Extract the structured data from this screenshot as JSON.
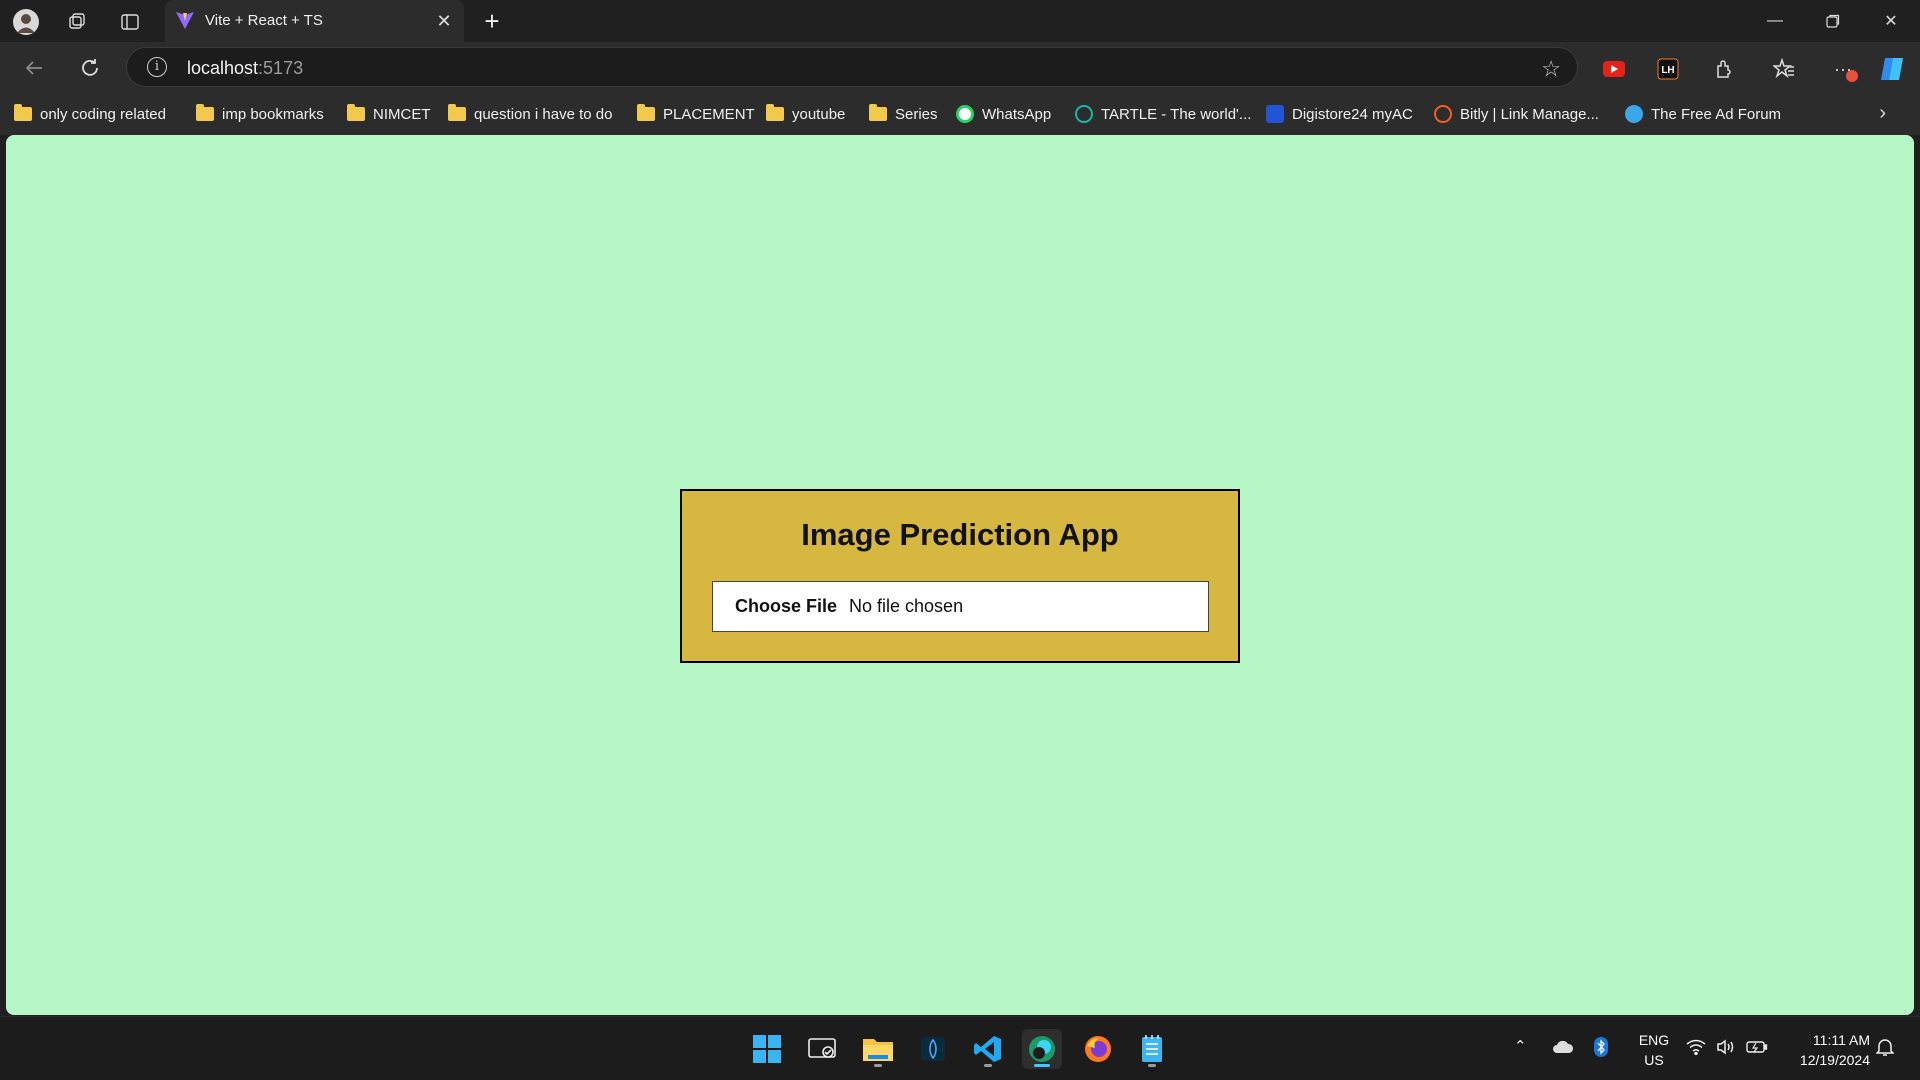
{
  "browser": {
    "tab_title": "Vite + React + TS",
    "url_host": "localhost",
    "url_port": ":5173"
  },
  "bookmarks": [
    {
      "label": "only coding  related",
      "icon": "folder-icon"
    },
    {
      "label": "imp bookmarks",
      "icon": "folder-icon"
    },
    {
      "label": "NIMCET",
      "icon": "folder-icon"
    },
    {
      "label": "question i have to do",
      "icon": "folder-icon"
    },
    {
      "label": "PLACEMENT",
      "icon": "folder-icon"
    },
    {
      "label": "youtube",
      "icon": "folder-icon"
    },
    {
      "label": "Series",
      "icon": "folder-icon"
    },
    {
      "label": "WhatsApp",
      "icon": "whatsapp-icon"
    },
    {
      "label": "TARTLE - The world'...",
      "icon": "tartle-icon"
    },
    {
      "label": "Digistore24 myAC",
      "icon": "digistore-icon"
    },
    {
      "label": "Bitly | Link Manage...",
      "icon": "bitly-icon"
    },
    {
      "label": "The Free Ad Forum",
      "icon": "freead-icon"
    }
  ],
  "app": {
    "title": "Image Prediction App",
    "choose_file_label": "Choose File",
    "no_file_label": "No file chosen"
  },
  "system": {
    "lang_line1": "ENG",
    "lang_line2": "US",
    "time": "11:11 AM",
    "date": "12/19/2024"
  },
  "colors": {
    "page_background": "#b5f7c6",
    "card_background": "#d6b841",
    "accent": "#4cc2ff"
  }
}
